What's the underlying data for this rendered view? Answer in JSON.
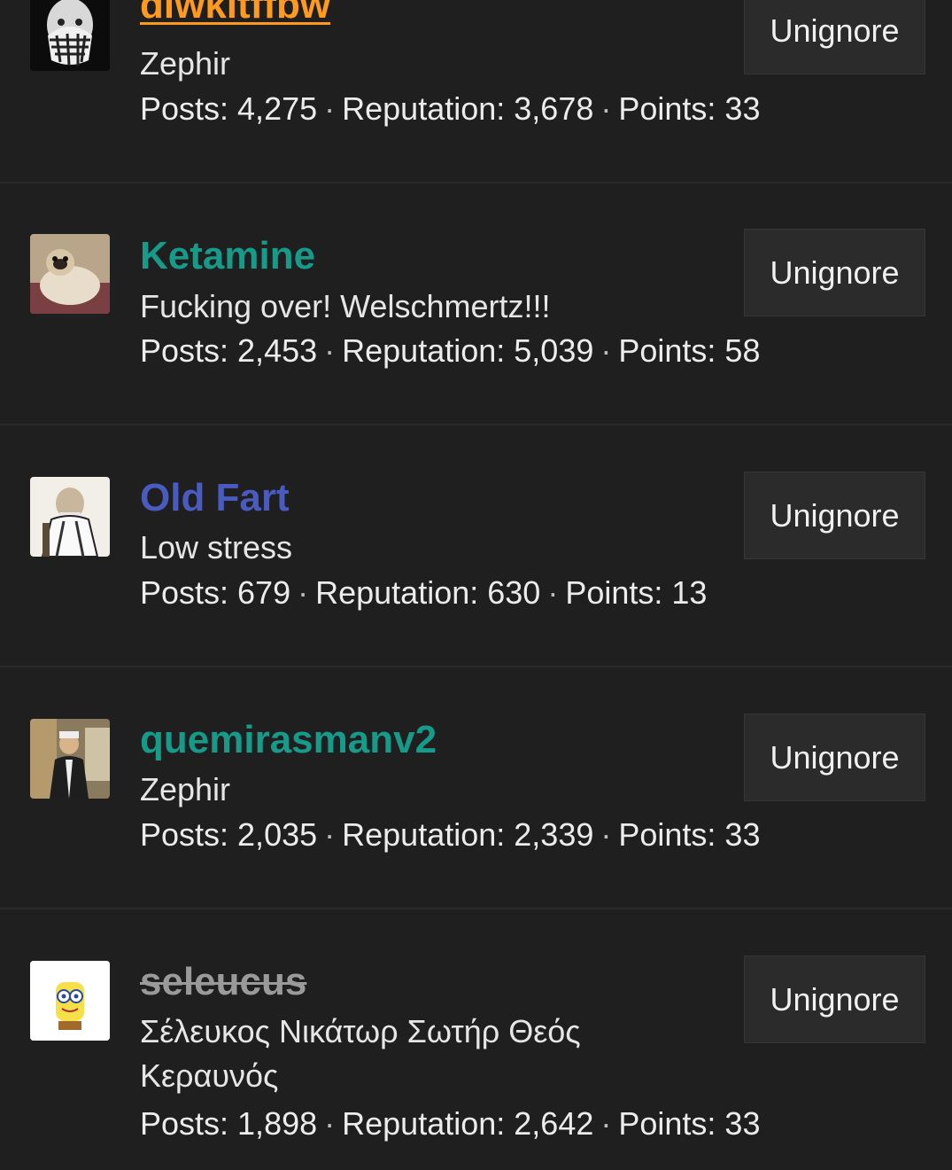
{
  "users": [
    {
      "username": "diwkitffbw",
      "title": "Zephir",
      "posts_label": "Posts: 4,275",
      "reputation_label": "Reputation: 3,678",
      "points_label": "Points: 33",
      "button_label": "Unignore",
      "username_color": "#ff9a1f"
    },
    {
      "username": "Ketamine",
      "title": "Fucking over! Welschmertz!!!",
      "posts_label": "Posts: 2,453",
      "reputation_label": "Reputation: 5,039",
      "points_label": "Points: 58",
      "button_label": "Unignore",
      "username_color": "#169a8a"
    },
    {
      "username": "Old Fart",
      "title": "Low stress",
      "posts_label": "Posts: 679",
      "reputation_label": "Reputation: 630",
      "points_label": "Points: 13",
      "button_label": "Unignore",
      "username_color": "#4a5bc0"
    },
    {
      "username": "quemirasmanv2",
      "title": "Zephir",
      "posts_label": "Posts: 2,035",
      "reputation_label": "Reputation: 2,339",
      "points_label": "Points: 33",
      "button_label": "Unignore",
      "username_color": "#169a8a"
    },
    {
      "username": "seleucus",
      "title": "Σέλευκος Νικάτωρ Σωτήρ Θεός Κεραυνός",
      "posts_label": "Posts: 1,898",
      "reputation_label": "Reputation: 2,642",
      "points_label": "Points: 33",
      "button_label": "Unignore",
      "username_color": "#9a9a9a"
    }
  ],
  "separator": "·",
  "colors": {
    "background": "#1f1f1f",
    "button_bg": "#2b2b2b",
    "divider": "#2a2a2a"
  }
}
